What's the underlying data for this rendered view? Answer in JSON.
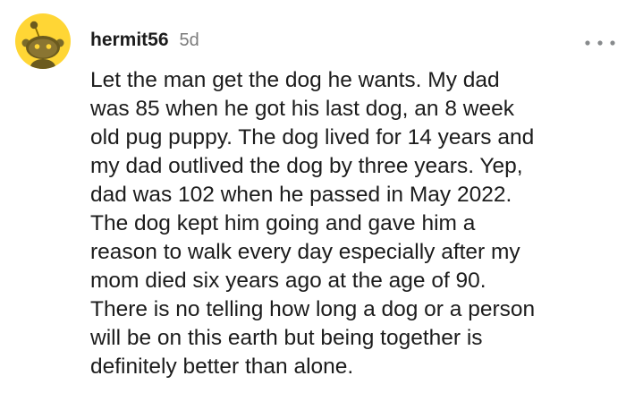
{
  "comment": {
    "author": "hermit56",
    "age": "5d",
    "more_icon": "more-horizontal-icon",
    "avatar_icon": "snoo-avatar-icon",
    "avatar_color": "#ffd635",
    "body_lines": [
      "Let the man get the dog he wants. My dad",
      "was 85 when he got his last dog, an 8 week",
      "old pug puppy. The dog lived for 14 years and",
      "my dad outlived the dog by three years. Yep,",
      "dad was 102 when he passed in May 2022.",
      "The dog kept him going and gave him a",
      "reason to walk every day especially after my",
      "mom died six years ago at the age of 90.",
      "There is no telling how long a dog or a person",
      "will be on this earth but being together is",
      "definitely better than alone."
    ]
  }
}
